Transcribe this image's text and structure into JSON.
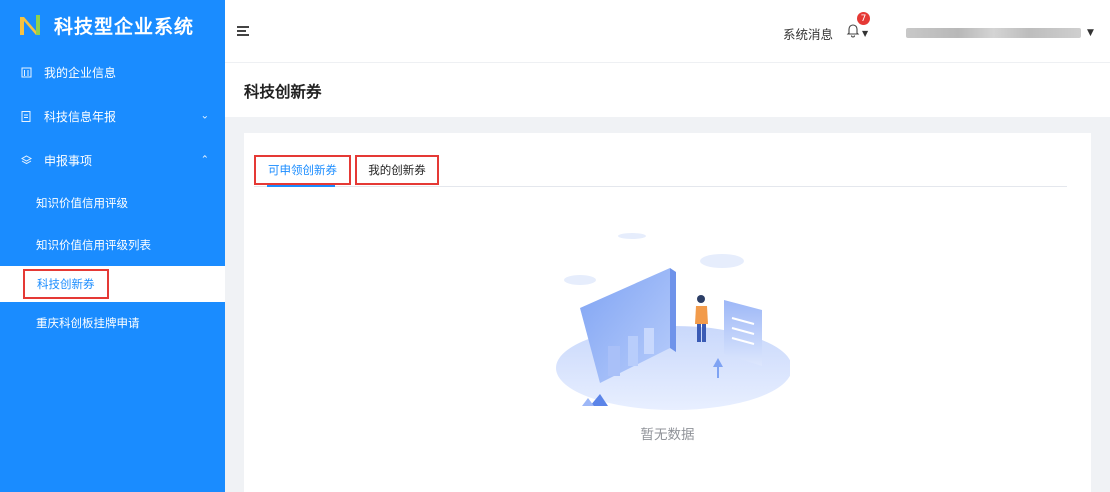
{
  "app": {
    "title": "科技型企业系统"
  },
  "sidebar": {
    "items": [
      {
        "label": "我的企业信息",
        "icon": "building-icon"
      },
      {
        "label": "科技信息年报",
        "icon": "document-icon",
        "expanded": false
      },
      {
        "label": "申报事项",
        "icon": "layers-icon",
        "expanded": true,
        "children": [
          {
            "label": "知识价值信用评级"
          },
          {
            "label": "知识价值信用评级列表"
          },
          {
            "label": "科技创新券",
            "active": true
          },
          {
            "label": "重庆科创板挂牌申请"
          }
        ]
      }
    ]
  },
  "header": {
    "system_message_label": "系统消息",
    "notification_count": "7"
  },
  "page": {
    "title": "科技创新券"
  },
  "tabs": [
    {
      "label": "可申领创新券",
      "active": true
    },
    {
      "label": "我的创新券",
      "active": false
    }
  ],
  "empty": {
    "text": "暂无数据"
  },
  "colors": {
    "primary": "#1a8cff",
    "highlight": "#e53935",
    "badge": "#e53935"
  }
}
